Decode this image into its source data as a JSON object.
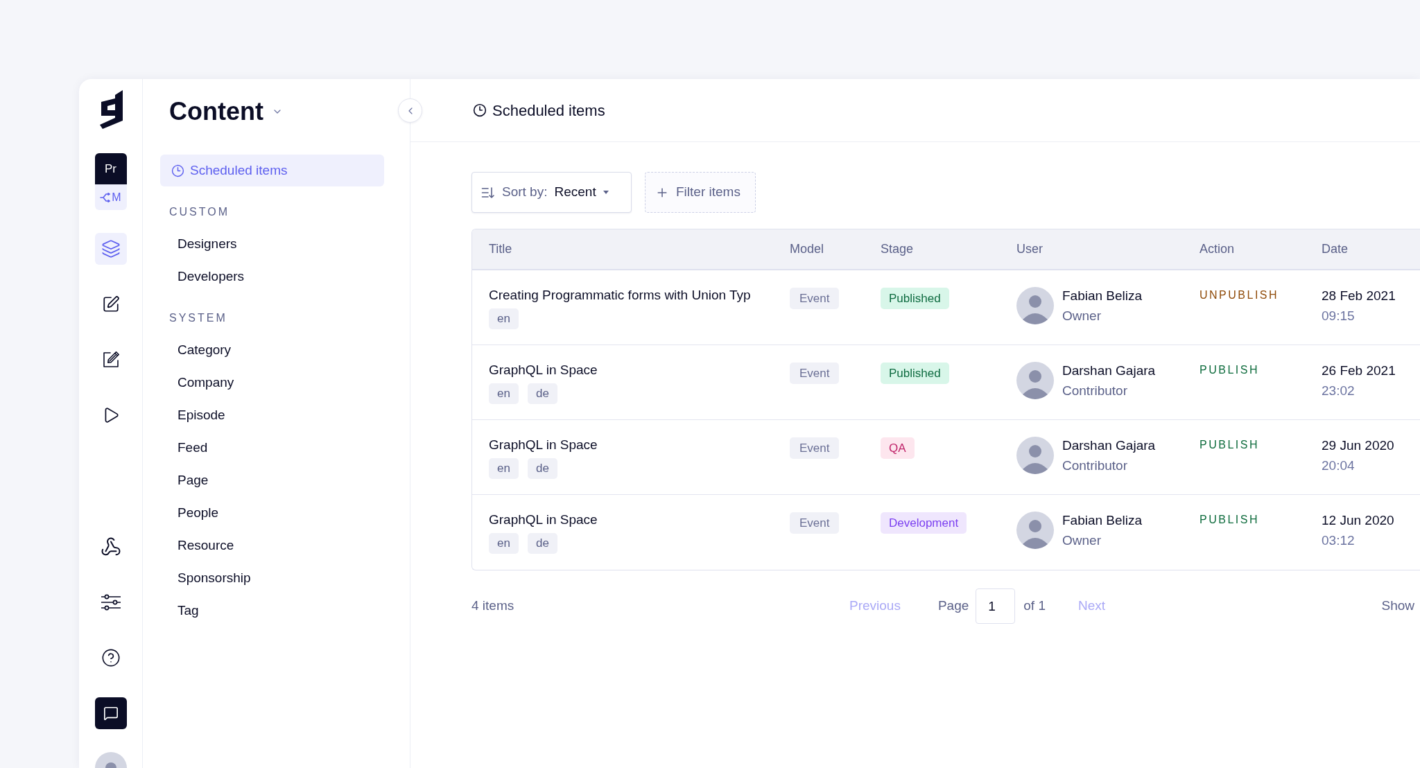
{
  "rail": {
    "project": {
      "label": "Pr",
      "environment": "M"
    },
    "nav": [
      {
        "selected": true
      },
      {
        "selected": false
      },
      {
        "selected": false
      },
      {
        "selected": false
      }
    ]
  },
  "sidebar": {
    "title": "Content",
    "pinned": {
      "label": "Scheduled items",
      "selected": true
    },
    "sections": [
      {
        "heading": "CUSTOM",
        "items": [
          {
            "label": "Designers",
            "selected": false
          },
          {
            "label": "Developers",
            "selected": false
          }
        ]
      },
      {
        "heading": "SYSTEM",
        "items": [
          {
            "label": "Category",
            "selected": false
          },
          {
            "label": "Company",
            "selected": false
          },
          {
            "label": "Episode",
            "selected": false
          },
          {
            "label": "Feed",
            "selected": false
          },
          {
            "label": "Page",
            "selected": false
          },
          {
            "label": "People",
            "selected": false
          },
          {
            "label": "Resource",
            "selected": false
          },
          {
            "label": "Sponsorship",
            "selected": false
          },
          {
            "label": "Tag",
            "selected": false
          }
        ]
      }
    ]
  },
  "header": {
    "title": "Scheduled items"
  },
  "toolbar": {
    "sort": {
      "label": "Sort by:",
      "value": "Recent"
    },
    "filter": {
      "label": "Filter items"
    }
  },
  "table": {
    "columns": [
      "Title",
      "Model",
      "Stage",
      "User",
      "Action",
      "Date"
    ],
    "rows": [
      {
        "title": "Creating Programmatic forms with Union Typ",
        "locales": [
          "en"
        ],
        "model": "Event",
        "stage": {
          "label": "Published",
          "kind": "published"
        },
        "user": {
          "name": "Fabian Beliza",
          "role": "Owner"
        },
        "action": {
          "label": "UNPUBLISH",
          "kind": "unpublish"
        },
        "date": "28 Feb 2021",
        "time": "09:15"
      },
      {
        "title": "GraphQL in Space",
        "locales": [
          "en",
          "de"
        ],
        "model": "Event",
        "stage": {
          "label": "Published",
          "kind": "published"
        },
        "user": {
          "name": "Darshan Gajara",
          "role": "Contributor"
        },
        "action": {
          "label": "PUBLISH",
          "kind": "publish"
        },
        "date": "26 Feb 2021",
        "time": "23:02"
      },
      {
        "title": "GraphQL in Space",
        "locales": [
          "en",
          "de"
        ],
        "model": "Event",
        "stage": {
          "label": "QA",
          "kind": "qa"
        },
        "user": {
          "name": "Darshan Gajara",
          "role": "Contributor"
        },
        "action": {
          "label": "PUBLISH",
          "kind": "publish"
        },
        "date": "29 Jun 2020",
        "time": "20:04"
      },
      {
        "title": "GraphQL in Space",
        "locales": [
          "en",
          "de"
        ],
        "model": "Event",
        "stage": {
          "label": "Development",
          "kind": "development"
        },
        "user": {
          "name": "Fabian Beliza",
          "role": "Owner"
        },
        "action": {
          "label": "PUBLISH",
          "kind": "publish"
        },
        "date": "12 Jun 2020",
        "time": "03:12"
      }
    ]
  },
  "pagination": {
    "count": "4 items",
    "previous": {
      "label": "Previous",
      "disabled": true
    },
    "page_label": "Page",
    "page_value": "1",
    "page_total": "of 1",
    "next": {
      "label": "Next",
      "disabled": true
    },
    "show_label": "Show"
  }
}
